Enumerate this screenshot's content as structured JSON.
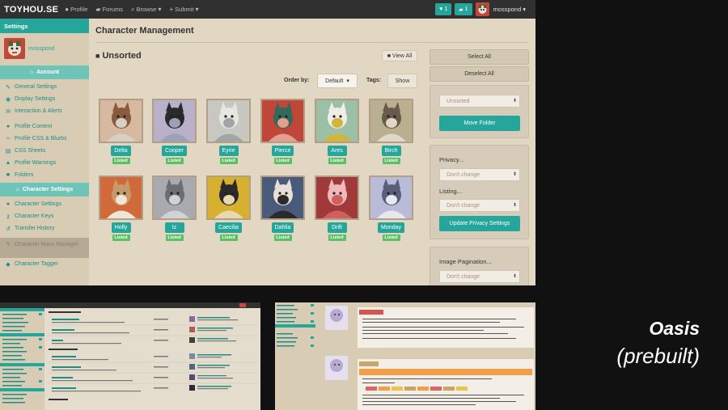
{
  "navbar": {
    "brand": "TOYHOU.SE",
    "links": [
      "Profile",
      "Forums",
      "Browse",
      "Submit"
    ],
    "badge1": "1",
    "badge2": "1",
    "username": "mosspond"
  },
  "sidebar": {
    "header": "Settings",
    "username": "mosspond",
    "section_account": "Account",
    "account_items": [
      "General Settings",
      "Display Settings",
      "Interaction & Alerts"
    ],
    "profile_items": [
      "Profile Content",
      "Profile CSS & Blurbs",
      "CSS Sheets",
      "Profile Warnings",
      "Folders"
    ],
    "section_character": "Character Settings",
    "character_items": [
      "Character Settings",
      "Character Keys",
      "Transfer History"
    ],
    "active_item": "Character Mass Manager",
    "tagger_item": "Character Tagger"
  },
  "main": {
    "title": "Character Management",
    "folder": "Unsorted",
    "view_all": "View All",
    "order_by_label": "Order by:",
    "order_by_value": "Default",
    "tags_label": "Tags:",
    "tags_button": "Show",
    "characters": [
      {
        "name": "Delta",
        "status": "Listed"
      },
      {
        "name": "Cooper",
        "status": "Listed"
      },
      {
        "name": "Eyrie",
        "status": "Listed"
      },
      {
        "name": "Pierce",
        "status": "Listed"
      },
      {
        "name": "Ares",
        "status": "Listed"
      },
      {
        "name": "Birch",
        "status": "Listed"
      },
      {
        "name": "Holly",
        "status": "Listed"
      },
      {
        "name": "Iz",
        "status": "Listed"
      },
      {
        "name": "Caecilia",
        "status": "Listed"
      },
      {
        "name": "Dahlia",
        "status": "Listed"
      },
      {
        "name": "Drift",
        "status": "Listed"
      },
      {
        "name": "Monday",
        "status": "Listed"
      }
    ]
  },
  "right": {
    "select_all": "Select All",
    "deselect_all": "Deselect All",
    "folder_select": "Unsorted",
    "move_folder": "Move Folder",
    "privacy_label": "Privacy...",
    "privacy_value": "Don't change",
    "listing_label": "Listing...",
    "listing_value": "Don't change",
    "update_privacy": "Update Privacy Settings",
    "pagination_label": "Image Pagination...",
    "pagination_value": "Don't change"
  },
  "overlay": {
    "theme_name": "Oasis",
    "theme_sub": "(prebuilt)"
  },
  "colors": {
    "accent": "#26a69a",
    "background": "#e2d7c3",
    "sidebar": "#d8ccb5",
    "navbar": "#303030",
    "listed": "#5bbf63"
  }
}
